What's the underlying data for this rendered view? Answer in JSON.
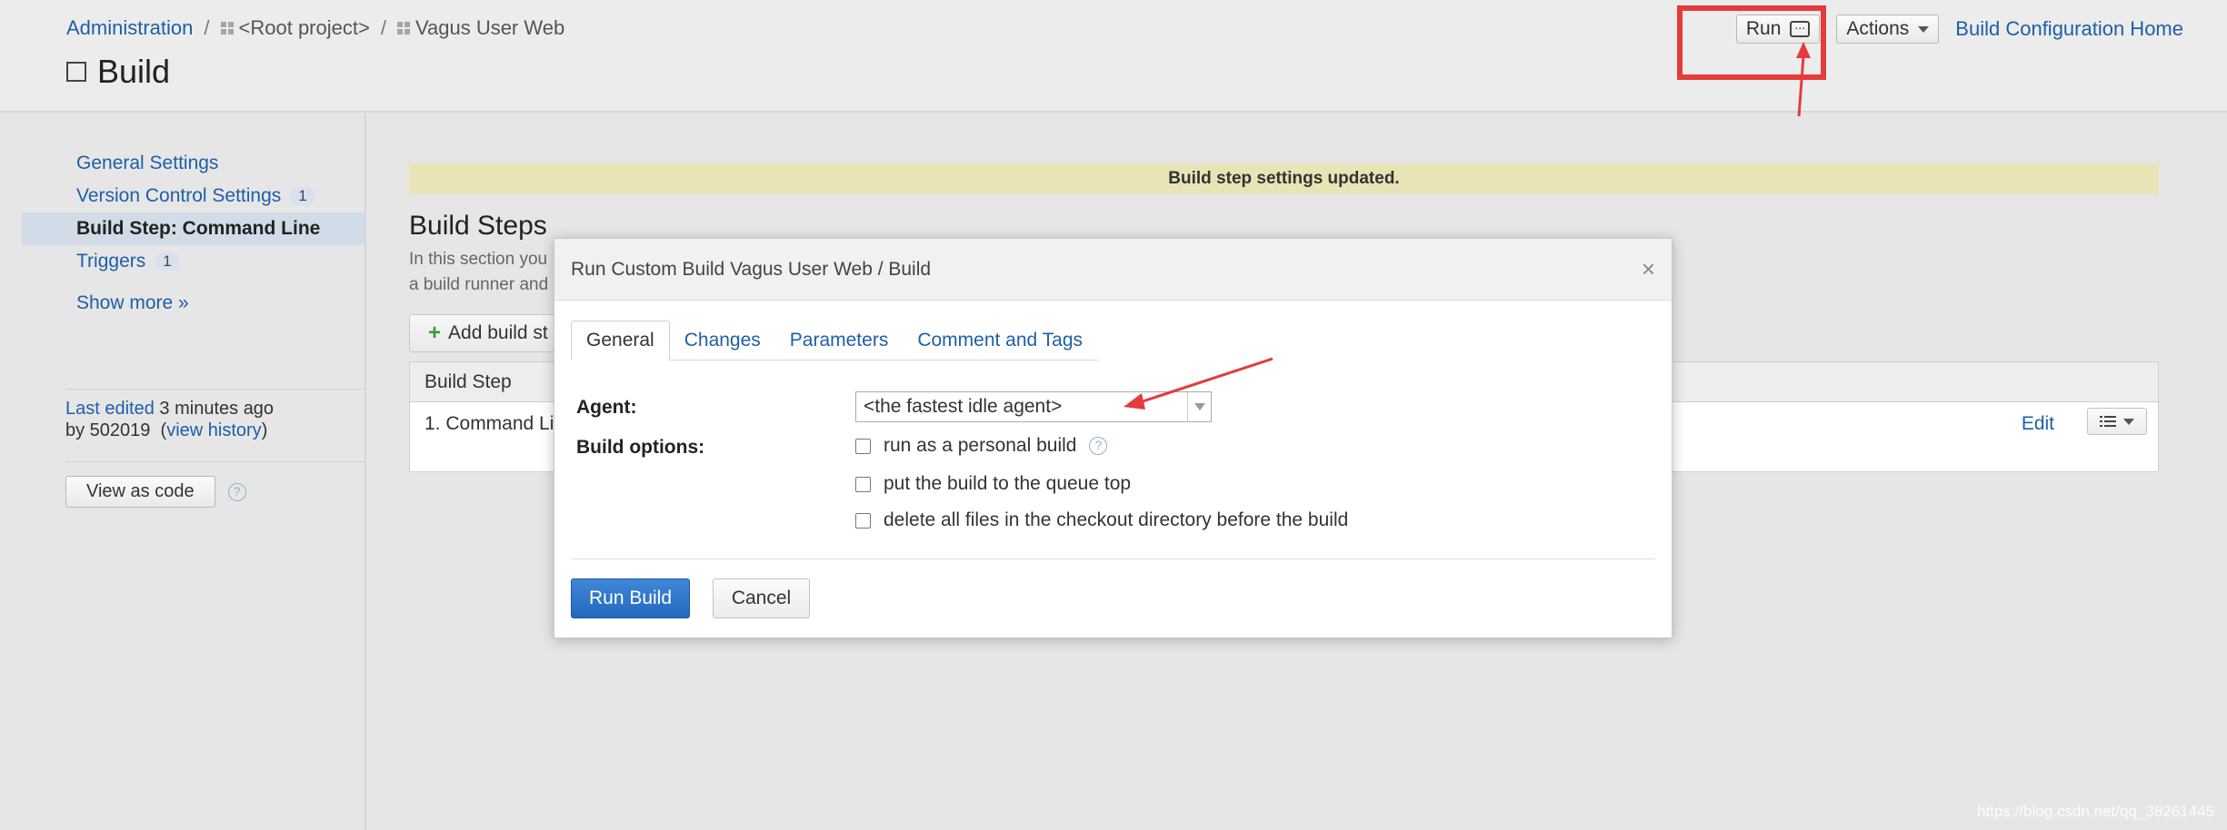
{
  "breadcrumb": {
    "items": [
      "Administration",
      "<Root project>",
      "Vagus User Web"
    ],
    "separator": "/"
  },
  "page": {
    "title": "Build"
  },
  "header": {
    "run_label": "Run",
    "actions_label": "Actions",
    "home_link": "Build Configuration Home"
  },
  "sidebar": {
    "items": [
      {
        "label": "General Settings",
        "badge": ""
      },
      {
        "label": "Version Control Settings",
        "badge": "1"
      },
      {
        "label": "Build Step: Command Line",
        "badge": ""
      },
      {
        "label": "Triggers",
        "badge": "1"
      }
    ],
    "show_more": "Show more »",
    "last_edited_link": "Last edited",
    "last_edited_time": "3 minutes ago",
    "by_text": "by 502019",
    "view_history": "view history",
    "view_code": "View as code"
  },
  "main": {
    "flash": "Build step settings updated.",
    "section_title": "Build Steps",
    "desc_line1": "In this section you",
    "desc_line2": "a build runner and",
    "add_step": "Add build st",
    "table_header": "Build Step",
    "row_name": "1. Command Lin",
    "row_edit": "Edit"
  },
  "dialog": {
    "title": "Run Custom Build Vagus User Web / Build",
    "close": "×",
    "tabs": [
      "General",
      "Changes",
      "Parameters",
      "Comment and Tags"
    ],
    "agent_label": "Agent:",
    "agent_value": "<the fastest idle agent>",
    "build_options_label": "Build options:",
    "options": [
      "run as a personal build",
      "put the build to the queue top",
      "delete all files in the checkout directory before the build"
    ],
    "run_button": "Run Build",
    "cancel_button": "Cancel"
  },
  "watermark": "https://blog.csdn.net/qq_38261445",
  "colors": {
    "link": "#1f5ea8",
    "annotation_red": "#e53b3b",
    "primary_button": "#2f78cc",
    "flash_bg": "#e8e4b6"
  }
}
